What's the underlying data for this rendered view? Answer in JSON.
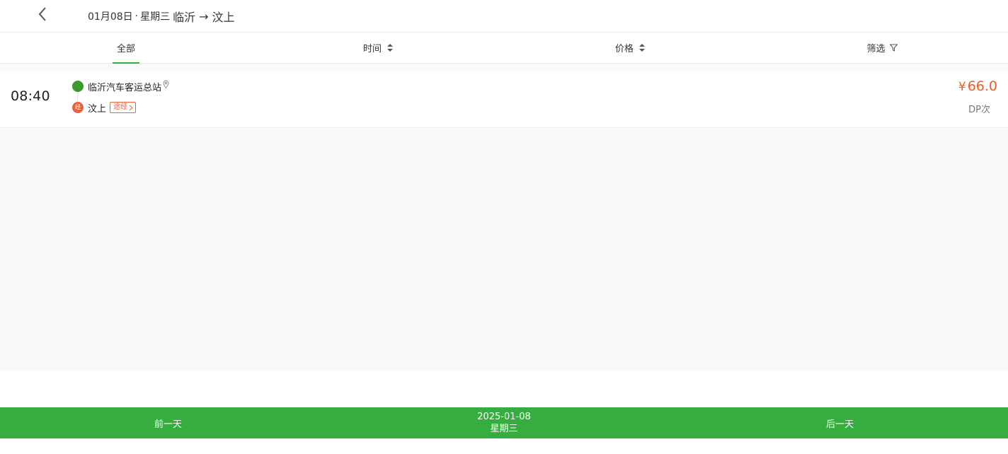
{
  "header": {
    "back_icon": "chevron-left-icon",
    "date": "01月08日",
    "separator": "·",
    "weekday": "星期三",
    "from": "临沂",
    "arrow": "→",
    "to": "汶上"
  },
  "tabs": [
    {
      "label": "全部",
      "active": true
    },
    {
      "label": "时间",
      "icon": "sort-icon"
    },
    {
      "label": "价格",
      "icon": "sort-icon"
    },
    {
      "label": "筛选",
      "icon": "filter-icon"
    }
  ],
  "trips": [
    {
      "depart_time": "08:40",
      "start_station": "临沂汽车客运总站",
      "via_badge": "经",
      "end_station": "汶上",
      "via_tag": "途经",
      "currency": "¥",
      "price": "66.0",
      "bus_no": "DP次"
    }
  ],
  "footer": {
    "prev_day": "前一天",
    "date": "2025-01-08",
    "weekday": "星期三",
    "next_day": "后一天"
  },
  "colors": {
    "brand_green": "#35ae3f",
    "start_dot": "#3a9a2b",
    "accent_orange": "#e9623b",
    "price": "#f05a24"
  }
}
